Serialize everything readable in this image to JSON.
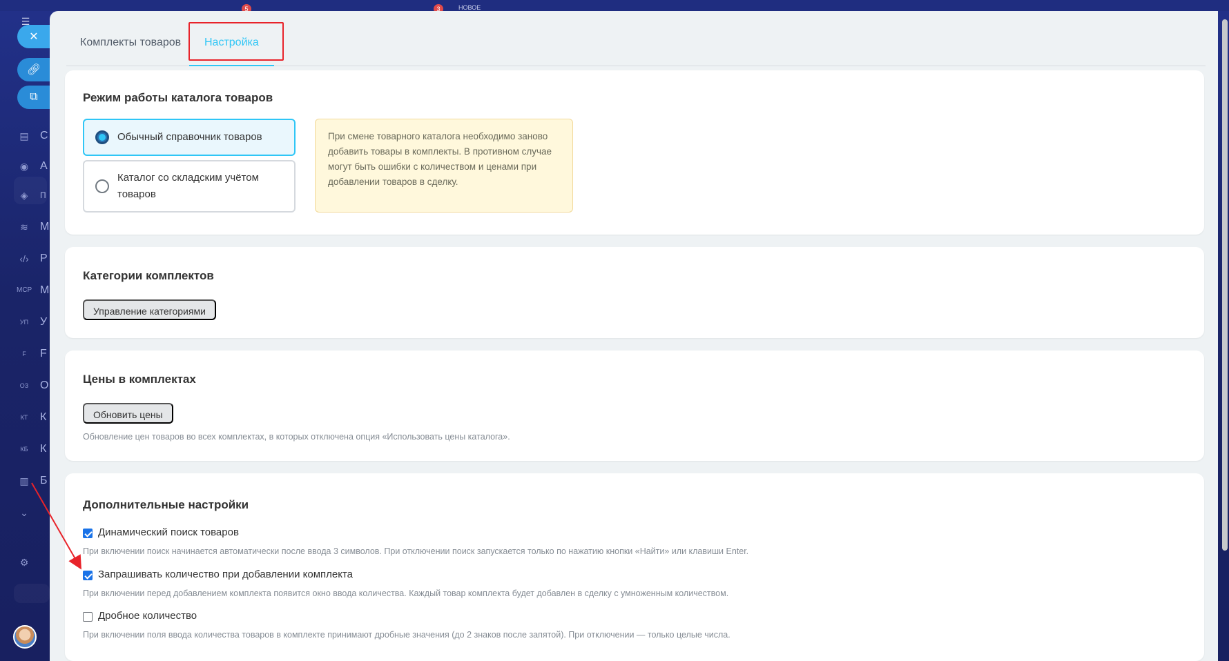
{
  "background": {
    "top_badges": [
      "5",
      "3"
    ],
    "top_label": "НОВОЕ",
    "rail_labels": [
      "С",
      "А",
      "П",
      "М",
      "Р",
      "М",
      "У",
      "F",
      "О",
      "К",
      "К",
      "Б"
    ],
    "rail_icon_labels": [
      "МСР",
      "УП",
      "F",
      "ОЗ",
      "КТ",
      "КБ"
    ]
  },
  "tabs": [
    {
      "label": "Комплекты товаров"
    },
    {
      "label": "Настройка",
      "active": true
    }
  ],
  "catalog_mode": {
    "title": "Режим работы каталога товаров",
    "options": [
      {
        "label": "Обычный справочник товаров",
        "selected": true
      },
      {
        "label": "Каталог со складским учётом товаров",
        "selected": false
      }
    ],
    "note": "При смене товарного каталога необходимо заново добавить товары в комплекты. В противном случае могут быть ошибки с количеством и ценами при добавлении товаров в сделку."
  },
  "categories": {
    "title": "Категории комплектов",
    "button": "Управление категориями"
  },
  "prices": {
    "title": "Цены в комплектах",
    "button": "Обновить цены",
    "hint": "Обновление цен товаров во всех комплектах, в которых отключена опция «Использовать цены каталога»."
  },
  "extra": {
    "title": "Дополнительные настройки",
    "options": [
      {
        "label": "Динамический поиск товаров",
        "checked": true,
        "hint": "При включении поиск начинается автоматически после ввода 3 символов. При отключении поиск запускается только по нажатию кнопки «Найти» или клавиши Enter."
      },
      {
        "label": "Запрашивать количество при добавлении комплекта",
        "checked": true,
        "hint": "При включении перед добавлением комплекта появится окно ввода количества. Каждый товар комплекта будет добавлен в сделку с умноженным количеством."
      },
      {
        "label": "Дробное количество",
        "checked": false,
        "hint": "При включении поля ввода количества товаров в комплекте принимают дробные значения (до 2 знаков после запятой). При отключении — только целые числа."
      }
    ]
  },
  "colors": {
    "accent": "#2fc6f6",
    "annotation": "#e8232a",
    "checkbox": "#1a73e8",
    "note_bg": "#fff8dc"
  }
}
